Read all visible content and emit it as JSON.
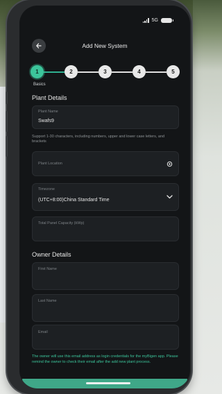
{
  "status_bar": {
    "network": "5G"
  },
  "header": {
    "title": "Add New System"
  },
  "stepper": {
    "steps": [
      "1",
      "2",
      "3",
      "4",
      "5"
    ],
    "active_label": "Basics"
  },
  "plant_details": {
    "section_title": "Plant Details",
    "plant_name": {
      "label": "Plant Name",
      "value": "Swafs9"
    },
    "helper_text": "Support 1-30 characters, including numbers, upper and lower case letters, and brackets",
    "plant_location": {
      "label": "Plant Location"
    },
    "timezone": {
      "label": "Timezone",
      "value": "(UTC+8:00)China Standard Time"
    },
    "panel_capacity": {
      "label": "Total Panel Capacity (kWp)"
    }
  },
  "owner_details": {
    "section_title": "Owner Details",
    "first_name": {
      "label": "First Name"
    },
    "last_name": {
      "label": "Last Name"
    },
    "email": {
      "label": "Email"
    },
    "note": "The owner will use this email address as login credentials for the myBigen app. Please remind the owner to check their email after the add new plant process."
  },
  "colors": {
    "accent": "#3cc59b",
    "screen_bg": "#131517",
    "field_bg": "#1d2023"
  }
}
